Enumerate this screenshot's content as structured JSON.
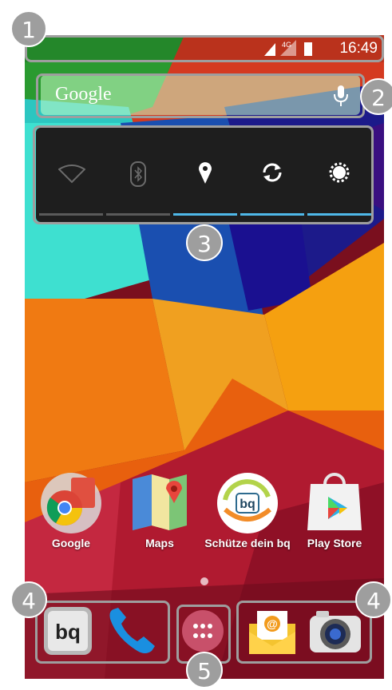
{
  "status_bar": {
    "network_label": "4G",
    "time": "16:49"
  },
  "search": {
    "label": "Google"
  },
  "quick_settings": {
    "toggles": [
      {
        "name": "wifi",
        "active": false
      },
      {
        "name": "bluetooth",
        "active": false
      },
      {
        "name": "location",
        "active": true
      },
      {
        "name": "sync",
        "active": true
      },
      {
        "name": "brightness",
        "active": true
      }
    ]
  },
  "apps": [
    {
      "label": "Google",
      "icon": "google-folder-icon"
    },
    {
      "label": "Maps",
      "icon": "maps-icon"
    },
    {
      "label": "Schütze dein bq",
      "icon": "bq-protect-icon"
    },
    {
      "label": "Play Store",
      "icon": "play-store-icon"
    }
  ],
  "app_icon_texts": {
    "bq_logo": "bq"
  },
  "dock": {
    "left": [
      "bq-app-icon",
      "phone-icon"
    ],
    "center": "app-drawer-icon",
    "right": [
      "email-icon",
      "camera-icon"
    ],
    "bq_text": "bq",
    "email_symbol": "@"
  },
  "annotations": {
    "badge_1": "1",
    "badge_2": "2",
    "badge_3": "3",
    "badge_4_left": "4",
    "badge_4_right": "4",
    "badge_5": "5"
  },
  "colors": {
    "accent_blue": "#4fb8e8",
    "annotation_gray": "#9e9e9e"
  }
}
